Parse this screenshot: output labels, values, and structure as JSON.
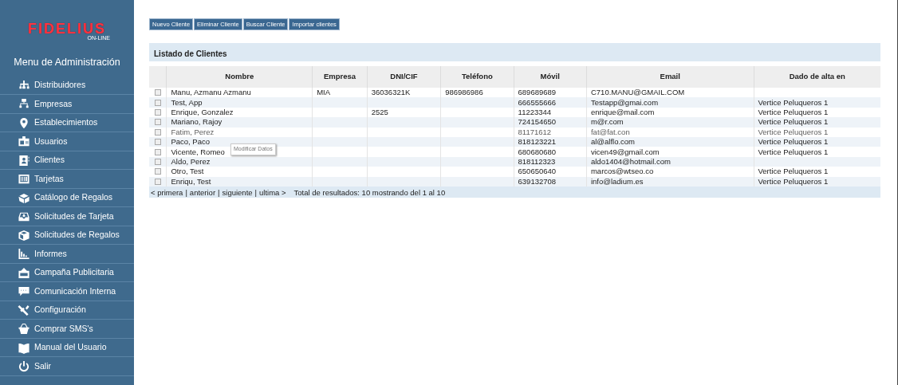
{
  "logo": {
    "name": "FIDELIUS",
    "tagline": "ON-LINE"
  },
  "sidebar": {
    "title": "Menu de Administración",
    "items": [
      {
        "label": "Distribuidores",
        "kind": "network"
      },
      {
        "label": "Empresas",
        "kind": "hierarchy"
      },
      {
        "label": "Establecimientos",
        "kind": "pin"
      },
      {
        "label": "Usuarios",
        "kind": "badge"
      },
      {
        "label": "Clientes",
        "kind": "contact"
      },
      {
        "label": "Tarjetas",
        "kind": "card"
      },
      {
        "label": "Catálogo de Regalos",
        "kind": "box"
      },
      {
        "label": "Solicitudes de Tarjeta",
        "kind": "inbox"
      },
      {
        "label": "Solicitudes de Regalos",
        "kind": "package"
      },
      {
        "label": "Informes",
        "kind": "chart"
      },
      {
        "label": "Campaña Publicitaria",
        "kind": "sale"
      },
      {
        "label": "Comunicación Interna",
        "kind": "chat"
      },
      {
        "label": "Configuración",
        "kind": "tools"
      },
      {
        "label": "Comprar SMS's",
        "kind": "basket"
      },
      {
        "label": "Manual del Usuario",
        "kind": "book"
      },
      {
        "label": "Salir",
        "kind": "power"
      }
    ]
  },
  "toolbar": [
    "Nuevo Cliente",
    "Eliminar Cliente",
    "Buscar Cliente",
    "Importar clientes"
  ],
  "panel": {
    "title": "Listado de Clientes",
    "table": {
      "columns": [
        "Nombre",
        "Empresa",
        "DNI/CIF",
        "Teléfono",
        "Móvil",
        "Email",
        "Dado de alta en"
      ],
      "rows": [
        {
          "checked": false,
          "muted": false,
          "cells": [
            "Manu, Azmanu Azmanu",
            "MIA",
            "36036321K",
            "986986986",
            "689689689",
            "C710.MANU@GMAIL.COM",
            ""
          ]
        },
        {
          "checked": false,
          "muted": false,
          "cells": [
            "Test, App",
            "",
            "",
            "",
            "666555666",
            "Testapp@gmai.com",
            "Vertice Peluqueros 1"
          ]
        },
        {
          "checked": false,
          "muted": false,
          "cells": [
            "Enrique, Gonzalez",
            "",
            "2525",
            "",
            "11223344",
            "enrique@mail.com",
            "Vertice Peluqueros 1"
          ]
        },
        {
          "checked": false,
          "muted": false,
          "cells": [
            "Mariano, Rajoy",
            "",
            "",
            "",
            "724154650",
            "m@r.com",
            "Vertice Peluqueros 1"
          ]
        },
        {
          "checked": false,
          "muted": true,
          "cells": [
            "Fatim, Perez",
            "",
            "",
            "",
            "81171612",
            "fat@fat.con",
            "Vertice Peluqueros 1"
          ]
        },
        {
          "checked": false,
          "muted": false,
          "cells": [
            "Paco, Paco",
            "",
            "",
            "",
            "818123221",
            "al@alflo.com",
            "Vertice Peluqueros 1"
          ]
        },
        {
          "checked": false,
          "muted": false,
          "cells": [
            "Vicente, Romeo",
            "",
            "",
            "",
            "680680680",
            "vicen49@gmail.com",
            "Vertice Peluqueros 1"
          ]
        },
        {
          "checked": false,
          "muted": false,
          "cells": [
            "Aldo, Perez",
            "",
            "",
            "",
            "818112323",
            "aldo1404@hotmail.com",
            ""
          ]
        },
        {
          "checked": false,
          "muted": false,
          "cells": [
            "Otro, Test",
            "",
            "",
            "",
            "650650640",
            "marcos@wtseo.co",
            "Vertice Peluqueros 1"
          ]
        },
        {
          "checked": false,
          "muted": false,
          "cells": [
            "Enriqu, Test",
            "",
            "",
            "",
            "639132708",
            "info@ladium.es",
            "Vertice Peluqueros 1"
          ]
        }
      ]
    },
    "pager": [
      "< primera",
      "anterior",
      "siguiente",
      "ultima >"
    ],
    "pager_separator": "|",
    "total": "Total de resultados: 10 mostrando del 1 al 10"
  },
  "tooltip": "Modificar Datos"
}
